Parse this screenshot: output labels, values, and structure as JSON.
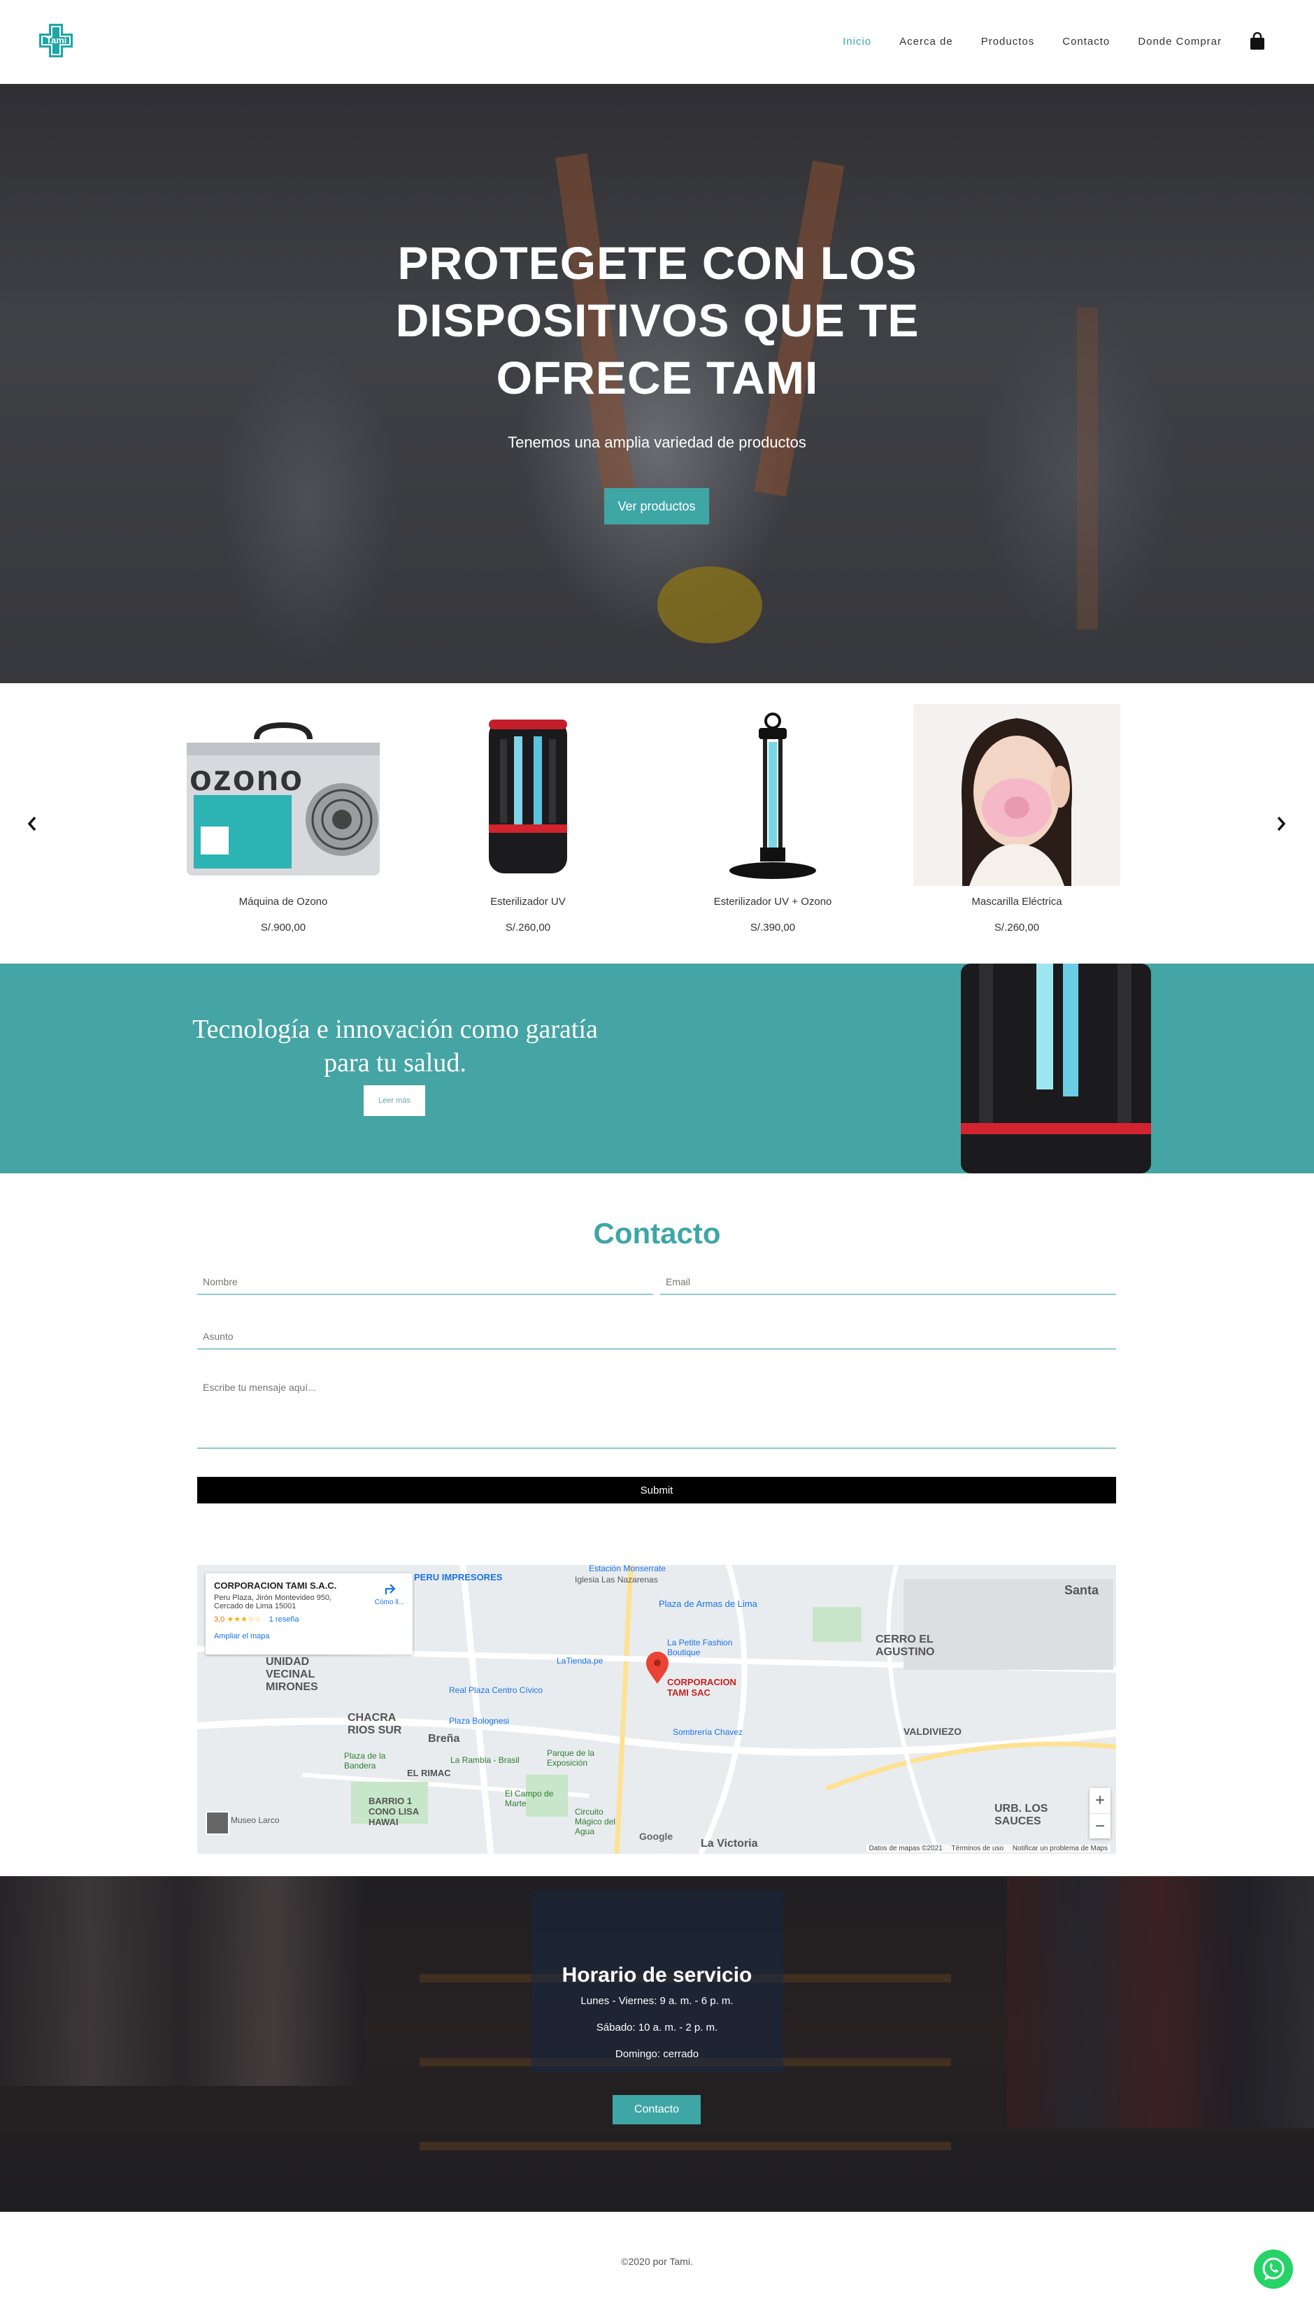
{
  "header": {
    "logo_text": "Tami",
    "nav": [
      "Inicio",
      "Acerca de",
      "Productos",
      "Contacto",
      "Donde Comprar"
    ]
  },
  "hero": {
    "title": "PROTEGETE CON LOS DISPOSITIVOS QUE TE OFRECE TAMI",
    "subtitle": "Tenemos una amplia variedad de productos",
    "button": "Ver productos"
  },
  "products": [
    {
      "name": "Máquina de Ozono",
      "price": "S/.900,00",
      "image_text": "ozono"
    },
    {
      "name": "Esterilizador UV",
      "price": "S/.260,00"
    },
    {
      "name": "Esterilizador UV + Ozono",
      "price": "S/.390,00"
    },
    {
      "name": "Mascarilla Eléctrica",
      "price": "S/.260,00"
    }
  ],
  "band": {
    "text": "Tecnología e innovación como garatía para tu salud.",
    "button": "Leer más"
  },
  "contact": {
    "title": "Contacto",
    "name_placeholder": "Nombre",
    "email_placeholder": "Email",
    "subject_placeholder": "Asunto",
    "message_placeholder": "Escribe tu mensaje aquí...",
    "submit": "Submit"
  },
  "map": {
    "business": "CORPORACION TAMI S.A.C.",
    "address1": "Peru Plaza, Jirón Montevideo 950,",
    "address2": "Cercado de Lima 15001",
    "rating": "3,0",
    "stars": "★★★☆☆",
    "reviews": "1 reseña",
    "enlarge": "Ampliar el mapa",
    "directions": "Cómo ll...",
    "pin_label1": "CORPORACION",
    "pin_label2": "TAMI SAC",
    "districts": [
      "UNIDAD VECINAL MIRONES",
      "CHACRA RIOS SUR",
      "BARRIO 1 CONO LISA HAWAI",
      "CERRO EL AGUSTINO",
      "URB. LOS SAUCES",
      "La Victoria",
      "Breña",
      "Santa",
      "VALDIVIEZO",
      "EL RIMAC"
    ],
    "pois": [
      "Estación Monserrate",
      "PERU IMPRESORES",
      "Iglesia Las Nazarenas",
      "Plaza de Armas de Lima",
      "La Petite Fashion Boutique",
      "LaTienda.pe",
      "Real Plaza Centro Cívico",
      "Plaza Bolognesi",
      "Sombrería Chavez",
      "Plaza de la Bandera",
      "La Rambla - Brasil",
      "Parque de la Exposición",
      "El Campo de Marte",
      "Circuito Mágico del Agua",
      "Museo Larco"
    ],
    "footer": [
      "Datos de mapas ©2021",
      "Términos de uso",
      "Notificar un problema de Maps"
    ]
  },
  "hours": {
    "title": "Horario de servicio",
    "line1": "Lunes - Viernes: 9 a. m. - 6 p. m.",
    "line2": "Sábado: 10 a. m. - 2 p. m.",
    "line3": "Domingo: cerrado",
    "button": "Contacto"
  },
  "footer": {
    "text": "©2020 por Tami."
  },
  "colors": {
    "accent": "#3fa6a6",
    "band": "#45a4a4",
    "submit": "#000000",
    "whatsapp": "#25d366"
  }
}
